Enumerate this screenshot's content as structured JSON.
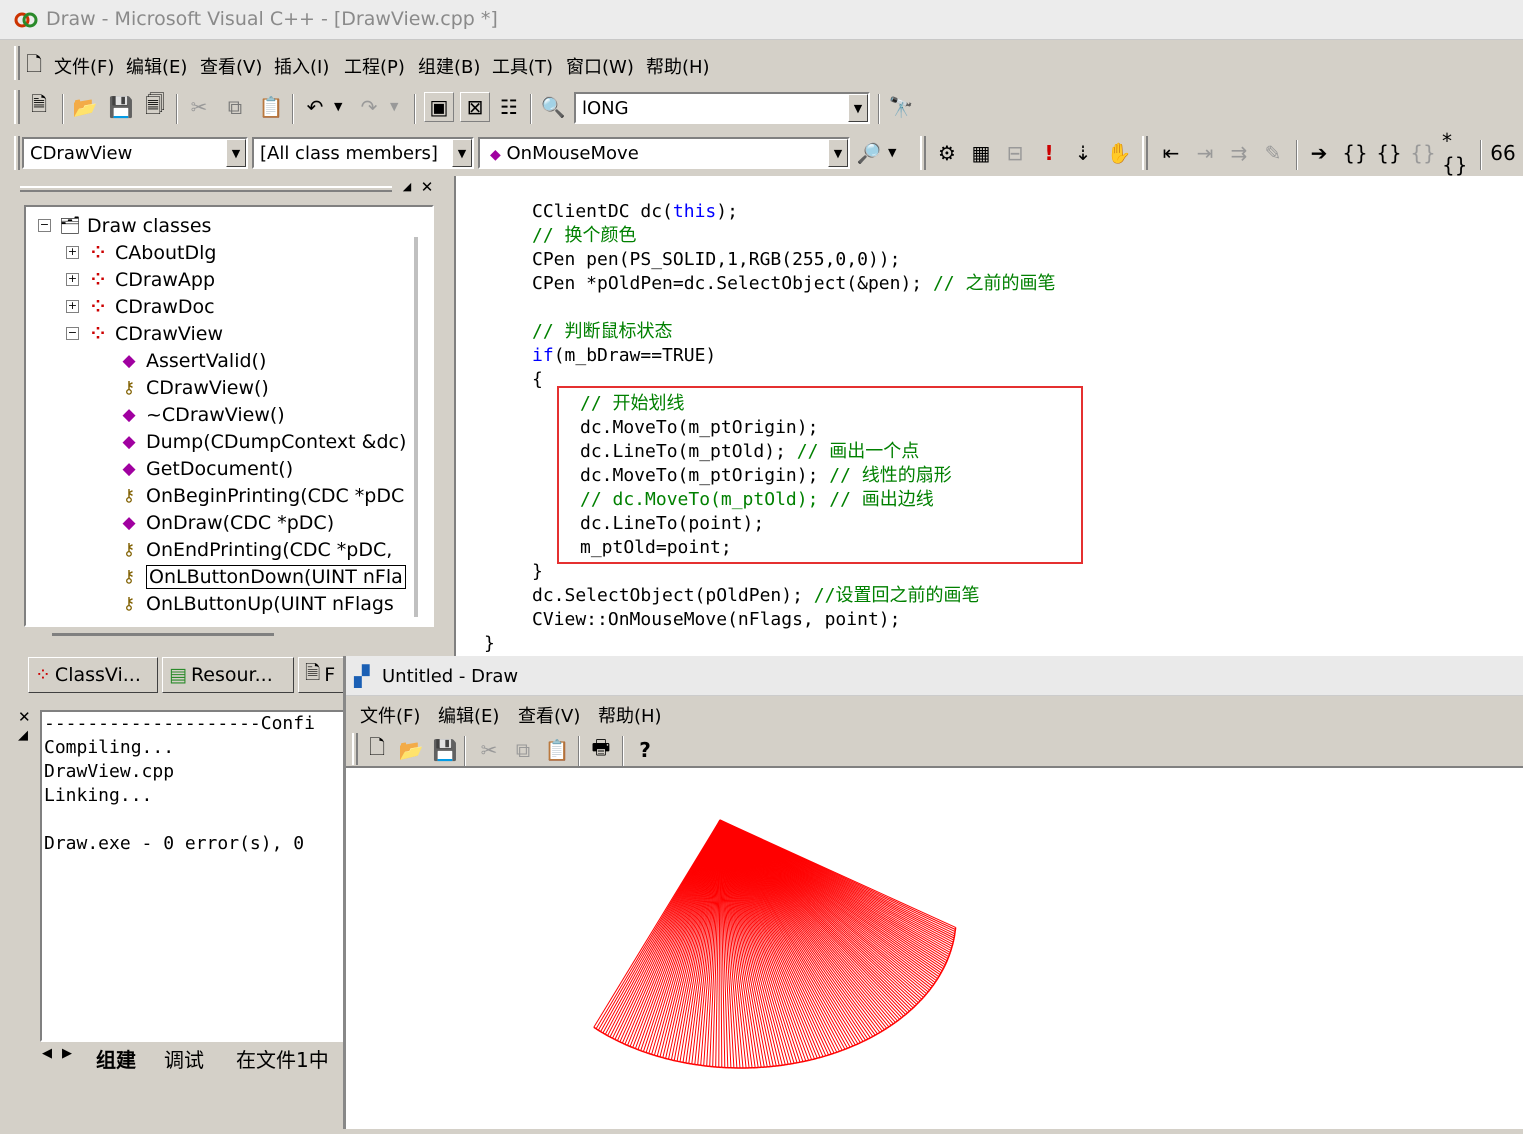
{
  "ide": {
    "title": "Draw - Microsoft Visual C++ - [DrawView.cpp *]",
    "menu": [
      "文件(F)",
      "编辑(E)",
      "查看(V)",
      "插入(I)",
      "工程(P)",
      "组建(B)",
      "工具(T)",
      "窗口(W)",
      "帮助(H)"
    ],
    "find_combo_value": "lONG",
    "wizard_bar": {
      "class_combo": "CDrawView",
      "filter_combo": "[All class members]",
      "member_combo": "OnMouseMove"
    }
  },
  "classview": {
    "root": "Draw classes",
    "classes": [
      "CAboutDlg",
      "CDrawApp",
      "CDrawDoc",
      "CDrawView"
    ],
    "members": [
      "AssertValid()",
      "CDrawView()",
      "~CDrawView()",
      "Dump(CDumpContext &dc)",
      "GetDocument()",
      "OnBeginPrinting(CDC *pDC",
      "OnDraw(CDC *pDC)",
      "OnEndPrinting(CDC *pDC,",
      "OnLButtonDown(UINT nFla",
      "OnLButtonUp(UINT nFlags"
    ],
    "tabs": [
      "ClassVi...",
      "Resour...",
      "F"
    ]
  },
  "editor": {
    "code": {
      "l1": "CClientDC dc(",
      "l1_kw": "this",
      "l1_end": ");",
      "l2_cm": "// 换个颜色",
      "l3": "CPen pen(PS_SOLID,1,RGB(255,0,0));",
      "l4": "CPen *pOldPen=dc.SelectObject(&pen); ",
      "l4_cm": "// 之前的画笔",
      "l6_cm": "// 判断鼠标状态",
      "l7_kw": "if",
      "l7": "(m_bDraw==TRUE)",
      "l8": "{",
      "l9_cm": "// 开始划线",
      "l10": "dc.MoveTo(m_ptOrigin);",
      "l11": "dc.LineTo(m_ptOld); ",
      "l11_cm": "// 画出一个点",
      "l12": "dc.MoveTo(m_ptOrigin); ",
      "l12_cm": "// 线性的扇形",
      "l13_cm": "// dc.MoveTo(m_ptOld); // 画出边线",
      "l14": "dc.LineTo(point);",
      "l15": "m_ptOld=point;",
      "l16": "}",
      "l17": "dc.SelectObject(pOldPen); ",
      "l17_cm": "//设置回之前的画笔",
      "l18": "CView::OnMouseMove(nFlags, point);",
      "l19": "}"
    }
  },
  "output": {
    "lines": [
      "--------------------Confi",
      "Compiling...",
      "DrawView.cpp",
      "Linking...",
      "",
      "Draw.exe - 0 error(s), 0"
    ],
    "tabs": [
      "组建",
      "调试",
      "在文件1中"
    ]
  },
  "app": {
    "title": "Untitled - Draw",
    "menu": [
      "文件(F)",
      "编辑(E)",
      "查看(V)",
      "帮助(H)"
    ],
    "stroke_color": "#ff0000",
    "fan_lines": 160
  }
}
